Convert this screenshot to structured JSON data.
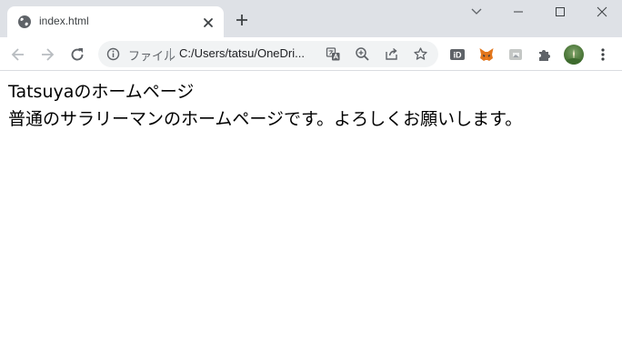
{
  "tab": {
    "title": "index.html"
  },
  "omnibox": {
    "chip_label": "ファイル",
    "url": "C:/Users/tatsu/OneDri..."
  },
  "page": {
    "heading": "Tatsuyaのホームページ",
    "paragraph": "普通のサラリーマンのホームページです。よろしくお願いします。"
  },
  "icons": {
    "favicon": "globe-icon",
    "tab_close": "close-icon",
    "new_tab": "plus-icon",
    "back": "arrow-left-icon",
    "forward": "arrow-right-icon",
    "reload": "reload-icon",
    "site_info": "info-icon",
    "translate": "translate-icon",
    "zoom": "zoom-icon",
    "share": "share-icon",
    "bookmark": "star-icon",
    "extensions": [
      "id-extension-icon",
      "metamask-fox-icon",
      "grey-extension-icon",
      "puzzle-icon"
    ],
    "menu": "kebab-menu-icon"
  },
  "colors": {
    "tabstrip_bg": "#dee1e6",
    "omnibox_bg": "#f1f3f4",
    "icon_gray": "#5f6368",
    "text": "#000000"
  }
}
